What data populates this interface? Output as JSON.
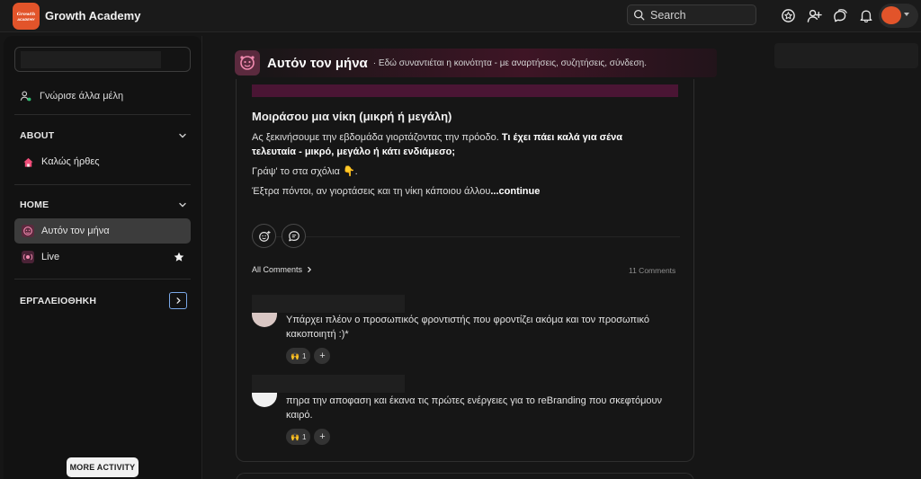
{
  "app": {
    "brand": "Growth Academy",
    "logo_text": "Growth Academy",
    "accent": "#e2542a"
  },
  "topbar": {
    "search_placeholder": "Search",
    "icons": [
      "search-icon",
      "spaces-icon",
      "add-member-icon",
      "chat-icon",
      "bell-icon"
    ]
  },
  "sidebar": {
    "meet_members": "Γνώρισε άλλα μέλη",
    "sections": {
      "about": {
        "title": "ABOUT",
        "items": [
          {
            "label": "Καλώς ήρθες",
            "icon": "home-icon"
          }
        ]
      },
      "home": {
        "title": "HOME",
        "items": [
          {
            "label": "Αυτόν τον μήνα",
            "icon": "community-icon",
            "active": true
          },
          {
            "label": "Live",
            "icon": "live-icon",
            "star": true
          }
        ]
      },
      "tools": {
        "title": "ΕΡΓΑΛΕΙΟΘΗΚΗ"
      }
    },
    "more_activity": "MORE ACTIVITY"
  },
  "channel": {
    "title": "Αυτόν τον μήνα",
    "description": "· Εδώ συναντιέται η κοινότητα - με αναρτήσεις, συζητήσεις, σύνδεση."
  },
  "post": {
    "title": "Μοιράσου μια νίκη (μικρή ή μεγάλη)",
    "intro": "Ας ξεκινήσουμε την εβδομάδα γιορτάζοντας την πρόοδο. ",
    "intro_bold": "Τι έχει πάει καλά για σένα τελευταία - μικρό, μεγάλο ή κάτι ενδιάμεσο;",
    "line2": "Γράψ' το στα σχόλια 👇.",
    "line3": "Έξτρα πόντοι, αν γιορτάσεις και τη νίκη κάποιου άλλου",
    "continue": "...continue",
    "all_comments": "All Comments",
    "comments_count": "11 Comments"
  },
  "comments": [
    {
      "text": "Υπάρχει πλέον ο προσωπικός φροντιστής που φροντίζει ακόμα και τον προσωπικό κακοποιητή :)",
      "suffix": "*",
      "reaction_emoji": "🙌",
      "reaction_count": "1",
      "add_reaction": "+"
    },
    {
      "text": "πηρα την αποφαση και έκανα τις πρώτες ενέργειες για το reBranding που σκεφτόμουν καιρό.",
      "reaction_emoji": "🙌",
      "reaction_count": "1",
      "add_reaction": "+"
    }
  ]
}
